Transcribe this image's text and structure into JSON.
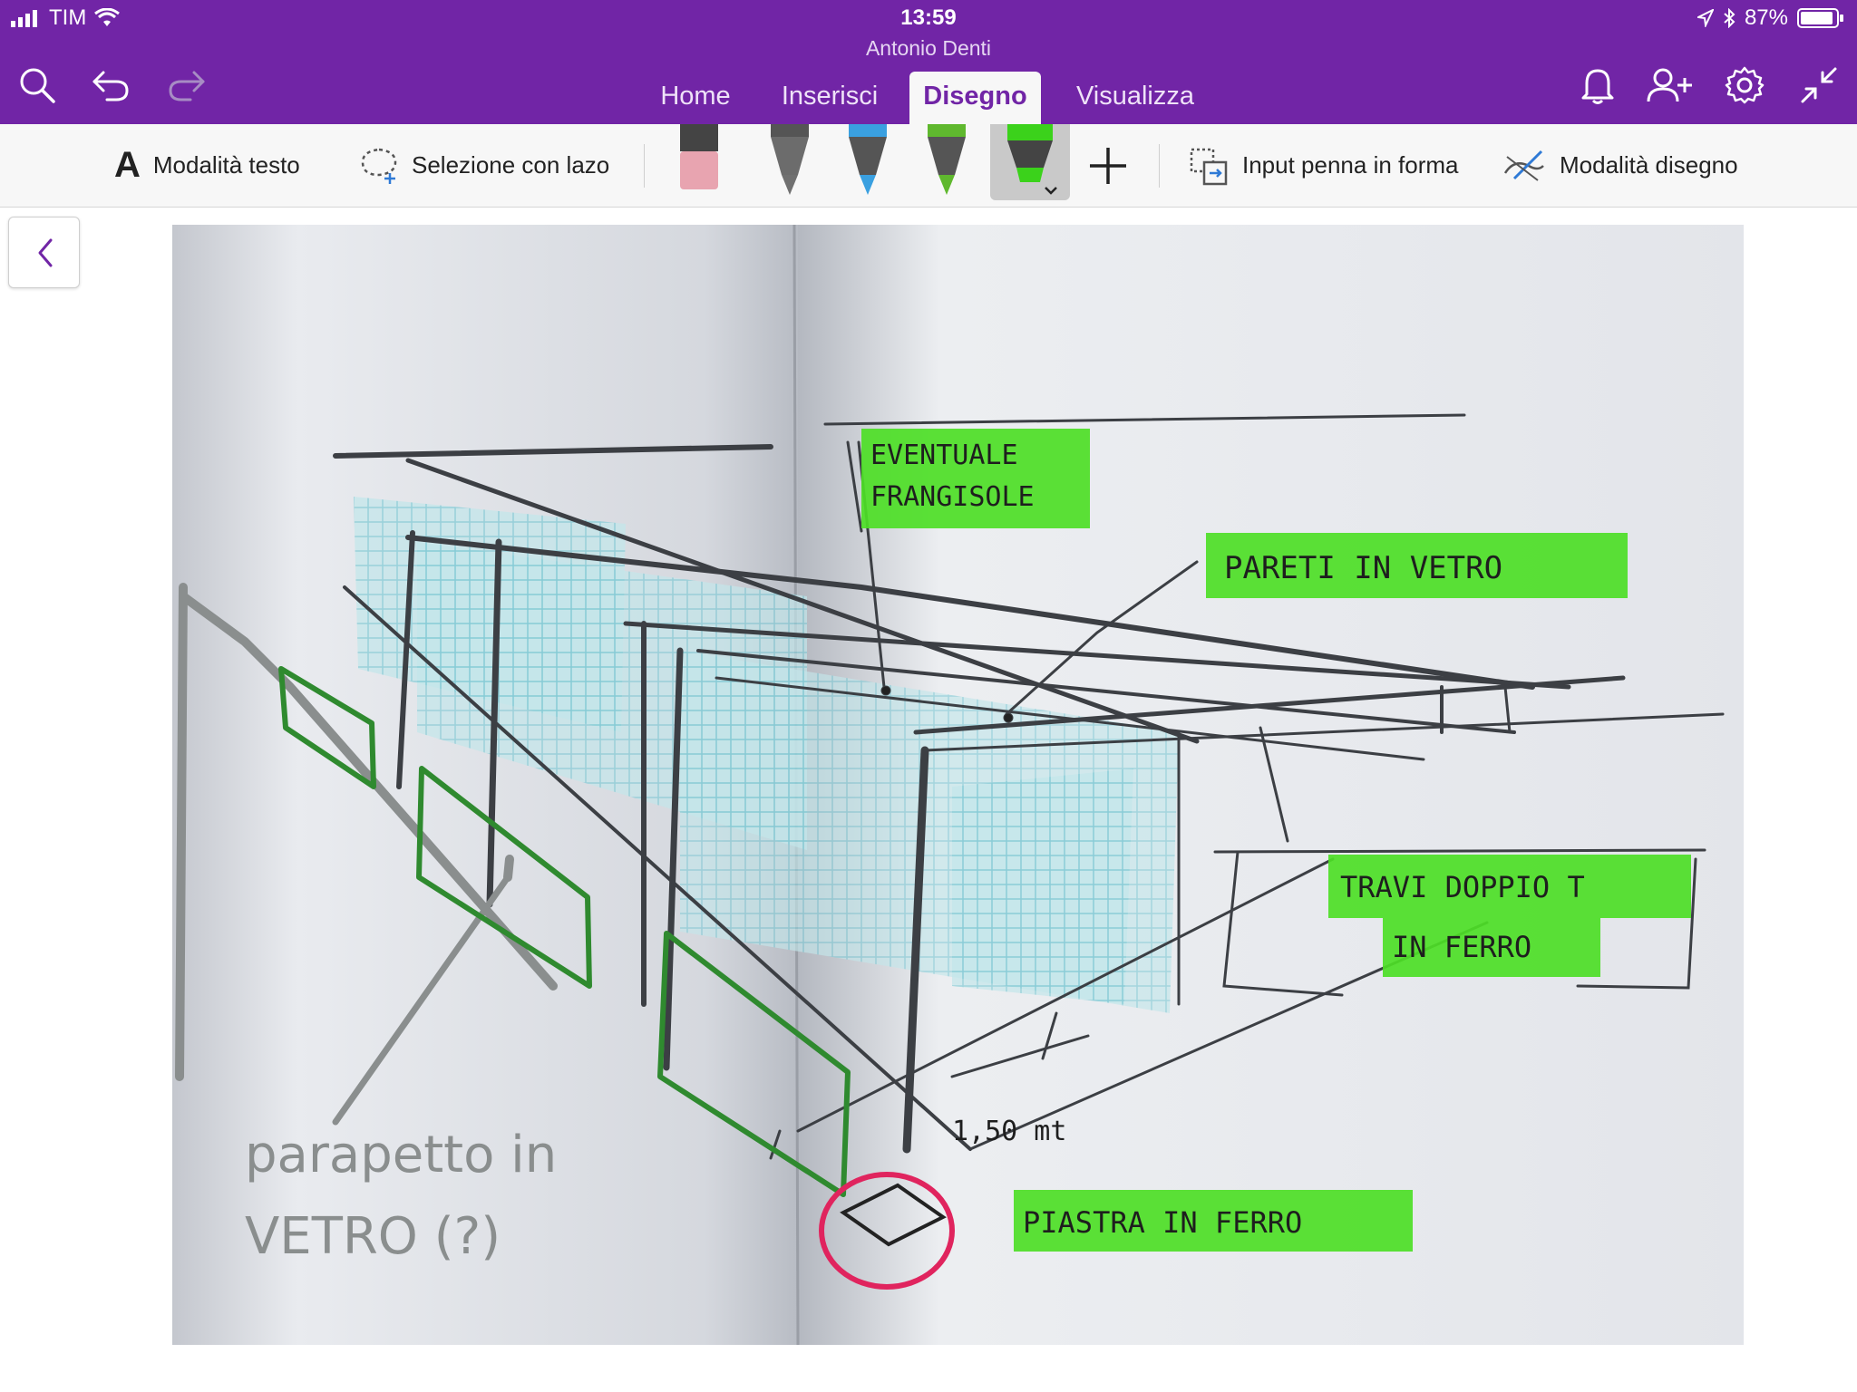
{
  "status_bar": {
    "carrier": "TIM",
    "time": "13:59",
    "battery": "87%"
  },
  "document": {
    "author": "Antonio Denti"
  },
  "tabs": [
    {
      "label": "Home",
      "active": false
    },
    {
      "label": "Inserisci",
      "active": false
    },
    {
      "label": "Disegno",
      "active": true
    },
    {
      "label": "Visualizza",
      "active": false
    }
  ],
  "toolbar": {
    "text_mode": "Modalità testo",
    "lasso": "Selezione con lazo",
    "ink_to_shape": "Input penna in forma",
    "draw_mode": "Modalità disegno"
  },
  "pens": [
    {
      "name": "eraser",
      "color": "#e8a4b0"
    },
    {
      "name": "pen-gray",
      "color": "#707070"
    },
    {
      "name": "pen-blue",
      "color": "#3aa0e0"
    },
    {
      "name": "pen-green",
      "color": "#5fb82e"
    },
    {
      "name": "highlighter-green",
      "color": "#3bd21b",
      "selected": true
    }
  ],
  "colors": {
    "header": "#7125a6",
    "toolbar": "#f7f7f7",
    "highlight": "#4dde26",
    "ink_gray": "#8a8e8e",
    "ink_green": "#2f8a2f",
    "ink_red": "#e0245e"
  },
  "sketch": {
    "labels": {
      "frangisole_1": "EVENTUALE",
      "frangisole_2": "FRANGISOLE",
      "pareti": "PARETI IN VETRO",
      "travi_1": "TRAVI DOPPIO T",
      "travi_2": "IN FERRO",
      "misura": "1,50 mt",
      "piastra": "PIASTRA IN FERRO",
      "parapetto_1": "parapetto in",
      "parapetto_2": "VETRO (?)"
    }
  }
}
